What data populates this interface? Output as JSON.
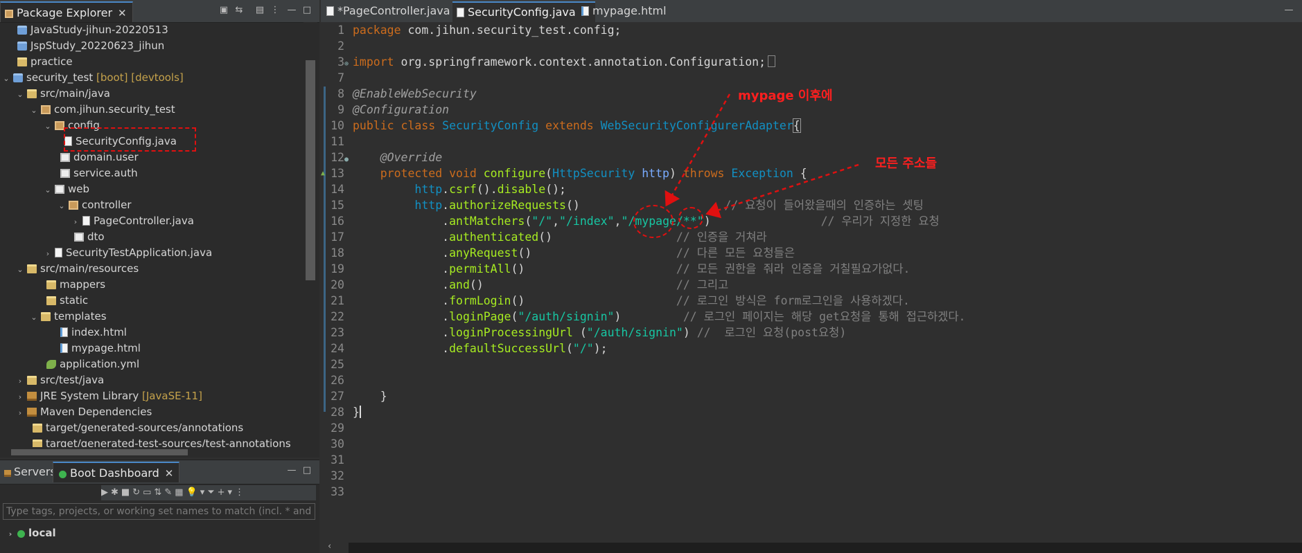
{
  "package_explorer": {
    "title": "Package Explorer",
    "items": [
      {
        "label": "JavaStudy-jihun-20220513",
        "deco": ""
      },
      {
        "label": "JspStudy_20220623_jihun",
        "deco": ""
      },
      {
        "label": "practice",
        "deco": ""
      },
      {
        "label": "security_test",
        "deco": "[boot] [devtools]"
      },
      {
        "label": "src/main/java",
        "deco": ""
      },
      {
        "label": "com.jihun.security_test",
        "deco": ""
      },
      {
        "label": "config",
        "deco": ""
      },
      {
        "label": "SecurityConfig.java",
        "deco": ""
      },
      {
        "label": "domain.user",
        "deco": ""
      },
      {
        "label": "service.auth",
        "deco": ""
      },
      {
        "label": "web",
        "deco": ""
      },
      {
        "label": "controller",
        "deco": ""
      },
      {
        "label": "PageController.java",
        "deco": ""
      },
      {
        "label": "dto",
        "deco": ""
      },
      {
        "label": "SecurityTestApplication.java",
        "deco": ""
      },
      {
        "label": "src/main/resources",
        "deco": ""
      },
      {
        "label": "mappers",
        "deco": ""
      },
      {
        "label": "static",
        "deco": ""
      },
      {
        "label": "templates",
        "deco": ""
      },
      {
        "label": "index.html",
        "deco": ""
      },
      {
        "label": "mypage.html",
        "deco": ""
      },
      {
        "label": "application.yml",
        "deco": ""
      },
      {
        "label": "src/test/java",
        "deco": ""
      },
      {
        "label": "JRE System Library",
        "deco": "[JavaSE-11]"
      },
      {
        "label": "Maven Dependencies",
        "deco": ""
      },
      {
        "label": "target/generated-sources/annotations",
        "deco": ""
      },
      {
        "label": "target/generated-test-sources/test-annotations",
        "deco": ""
      }
    ]
  },
  "bottom_panel": {
    "tabs": [
      "Servers",
      "Boot Dashboard"
    ],
    "filter_placeholder": "Type tags, projects, or working set names to match (incl. * and ? wildcards)",
    "local_label": "local"
  },
  "editor": {
    "tabs": [
      "*PageController.java",
      "SecurityConfig.java",
      "mypage.html"
    ],
    "active_tab": 1,
    "line_numbers": [
      "1",
      "2",
      "3",
      "7",
      "8",
      "9",
      "10",
      "11",
      "12",
      "13",
      "14",
      "15",
      "16",
      "17",
      "18",
      "19",
      "20",
      "21",
      "22",
      "23",
      "24",
      "25",
      "26",
      "27",
      "28",
      "29",
      "30",
      "31",
      "32",
      "33"
    ],
    "code": {
      "l1": "com.jihun.security_test.config;",
      "l3": "org.springframework.context.annotation.Configuration;",
      "l8": "@EnableWebSecurity",
      "l9": "@Configuration",
      "l10_class": "SecurityConfig",
      "l10_super": "WebSecurityConfigurerAdapter",
      "l12": "@Override",
      "l13_method": "configure",
      "l13_param_type": "HttpSecurity",
      "l13_param": "http",
      "l13_exc": "Exception",
      "l14": "http.csrf().disable();",
      "l15_comment": "// 요청이 들어왔을때의 인증하는 셋팅",
      "l16_comment": "// 우리가 지정한 요청",
      "l17_comment": "// 인증을 거쳐라",
      "l18_comment": "// 다른 모든 요청들은",
      "l19_comment": "// 모든 권한을 줘라 인증을 거칠필요가없다.",
      "l20_comment": "// 그리고",
      "l21_comment": "// 로그인 방식은 form로그인을 사용하겠다.",
      "l22_comment": "// 로그인 페이지는 해당 get요청을 통해 접근하겠다.",
      "l23_comment": "//  로그인 요청(post요청)"
    }
  },
  "annotations": {
    "mypage_note": "mypage 이후에",
    "all_addresses_note": "모든 주소들"
  },
  "colors": {
    "keyword": "#cc6c1d",
    "type": "#1290c3",
    "method": "#a7ec21",
    "string": "#17c6a3",
    "comment": "#808080",
    "annotation_red": "#e01010"
  }
}
